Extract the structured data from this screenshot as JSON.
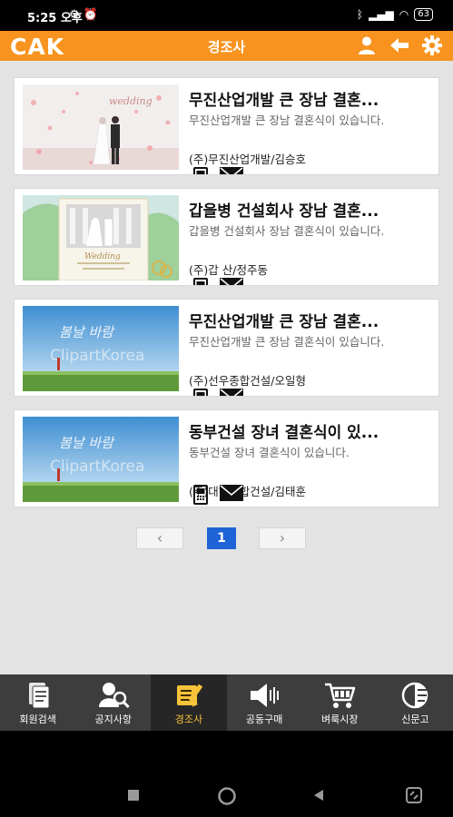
{
  "status_bar": {
    "time": "5:25 오후",
    "battery": "63"
  },
  "header": {
    "logo": "CAK",
    "title": "경조사",
    "accent": "#f7931e"
  },
  "header_icons": [
    "user-icon",
    "back-arrow-icon",
    "gear-icon"
  ],
  "posts": [
    {
      "title": "무진산업개발 큰 장남 결혼...",
      "desc": "무진산업개발 큰 장남 결혼식이 있습니다.",
      "author": "(주)무진산업개발/김승호",
      "thumb": "wedding-couple"
    },
    {
      "title": "갑을병 건설회사 장남 결혼...",
      "desc": "갑을병 건설회사 장남 결혼식이 있습니다.",
      "author": "(주)갑 산/정주동",
      "thumb": "wedding-invitation"
    },
    {
      "title": "무진산업개발 큰 장남 결혼...",
      "desc": "무진산업개발 큰 장남 결혼식이 있습니다.",
      "author": "(주)선우종합건설/오일형",
      "thumb": "sky-field"
    },
    {
      "title": "동부건설 장녀 결혼식이 있...",
      "desc": "동부건설 장녀 결혼식이 있습니다.",
      "author": "(주)대하종합건설/김태훈",
      "thumb": "sky-field"
    }
  ],
  "pagination": {
    "prev": "‹",
    "current": "1",
    "next": "›"
  },
  "bottom_nav": [
    {
      "label": "회원검색",
      "icon": "member-search-icon",
      "active": false
    },
    {
      "label": "공지사항",
      "icon": "notice-icon",
      "active": false
    },
    {
      "label": "경조사",
      "icon": "events-icon",
      "active": true
    },
    {
      "label": "공동구매",
      "icon": "group-buy-icon",
      "active": false
    },
    {
      "label": "벼룩시장",
      "icon": "flea-market-icon",
      "active": false
    },
    {
      "label": "신문고",
      "icon": "petition-icon",
      "active": false
    }
  ]
}
